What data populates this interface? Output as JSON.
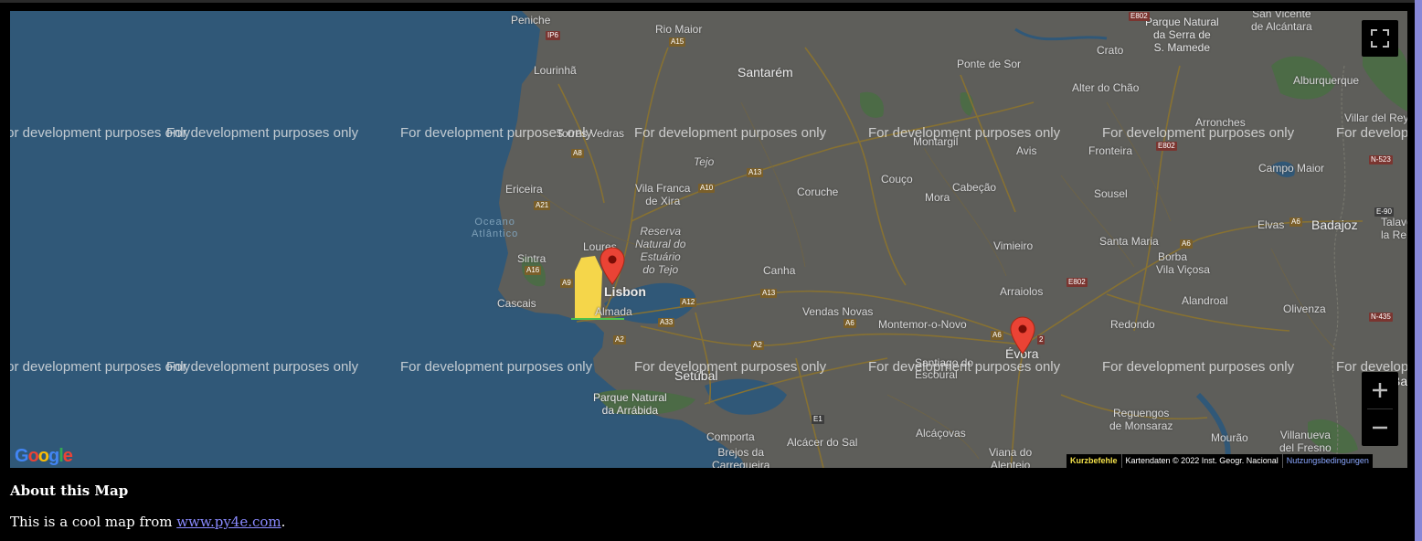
{
  "map": {
    "watermark": "For development purposes only",
    "places": {
      "peniche": "Peniche",
      "rio_maior": "Rio Maior",
      "santarem": "Santarém",
      "lourinha": "Lourinhã",
      "torres_vedras": "Torres Vedras",
      "crato": "Crato",
      "ponte_de_sor": "Ponte de Sor",
      "alter_do_chao": "Alter do Chão",
      "serra_mamede": "Parque Natural\nda Serra de\nS. Mamede",
      "s_vicente": "San Vicente\nde Alcántara",
      "alburquerque": "Alburquerque",
      "arronches": "Arronches",
      "villar_del_rey": "Villar del Rey",
      "montargil": "Montargil",
      "avis": "Avis",
      "fronteira": "Fronteira",
      "campo_maior": "Campo Maior",
      "tejo": "Tejo",
      "ericeira": "Ericeira",
      "vila_franca": "Vila Franca\nde Xira",
      "coruche": "Coruche",
      "couco": "Couço",
      "mora": "Mora",
      "cabecao": "Cabeção",
      "sousel": "Sousel",
      "elvas": "Elvas",
      "badajoz": "Badajoz",
      "talavera": "Talave\nla Re",
      "reserva": "Reserva\nNatural do\nEstuário\ndo Tejo",
      "loures": "Loures",
      "sintra": "Sintra",
      "vimieiro": "Vimieiro",
      "santa_maria": "Santa Maria",
      "borba": "Borba",
      "vila_vicosa": "Vila Viçosa",
      "lisbon": "Lisbon",
      "canha": "Canha",
      "arraiolos": "Arraiolos",
      "cascais": "Cascais",
      "almada": "Almada",
      "alandroal": "Alandroal",
      "olivenza": "Olivenza",
      "vendas_novas": "Vendas Novas",
      "montemor": "Montemor-o-Novo",
      "redondo": "Redondo",
      "evora": "Évora",
      "escoural": "Escoural",
      "setubal": "Setúbal",
      "arrabida": "Parque Natural\nda Arrábida",
      "reguengos": "Reguengos\nde Monsaraz",
      "villanueva": "Villanueva\ndel Fresno",
      "comporta": "Comporta",
      "brejos": "Brejos da\nCarregueira",
      "alcacer": "Alcácer do Sal",
      "alcacovas": "Alcáçovas",
      "viana": "Viana do\nAlentejo",
      "mourao": "Mourão",
      "ocean": "Oceano\nAtlântico",
      "santiago": "Santiago do",
      "partial_b": "Ba"
    },
    "roads": {
      "a15": "A15",
      "ip6": "IP6",
      "a8": "A8",
      "a9": "A9",
      "a21": "A21",
      "a10": "A10",
      "a13": "A13",
      "a16": "A16",
      "a12": "A12",
      "a13b": "A13",
      "a33": "A33",
      "a2": "A2",
      "a2b": "A2",
      "a6": "A6",
      "a6b": "A6",
      "a6c": "A6",
      "a6d": "A6",
      "e802": "E802",
      "e802b": "E802",
      "e802c": "E802",
      "n523": "N-523",
      "e90": "E-90",
      "n435": "N-435",
      "e1": "E1",
      "n802": "E802",
      "r2": "2"
    },
    "controls": {
      "fullscreen_icon": "fullscreen-icon",
      "zoom_in_icon": "plus-icon",
      "zoom_out_icon": "minus-icon"
    },
    "attribution": {
      "shortcuts": "Kurzbefehle",
      "data": "Kartendaten © 2022 Inst. Geogr. Nacional",
      "terms": "Nutzungsbedingungen"
    },
    "logo": "Google",
    "markers": [
      {
        "name": "Lisbon",
        "color": "#ea4335"
      },
      {
        "name": "Évora",
        "color": "#ea4335"
      }
    ]
  },
  "page": {
    "heading": "About this Map",
    "text_before": "This is a cool map from ",
    "link": "www.py4e.com",
    "text_after": "."
  },
  "colors": {
    "land": "#5e5e5a",
    "ocean": "#305878",
    "roads": "#8a7330",
    "marker": "#ea4335",
    "link": "#8a8aff",
    "sidebar_accent": "#8888d8"
  }
}
